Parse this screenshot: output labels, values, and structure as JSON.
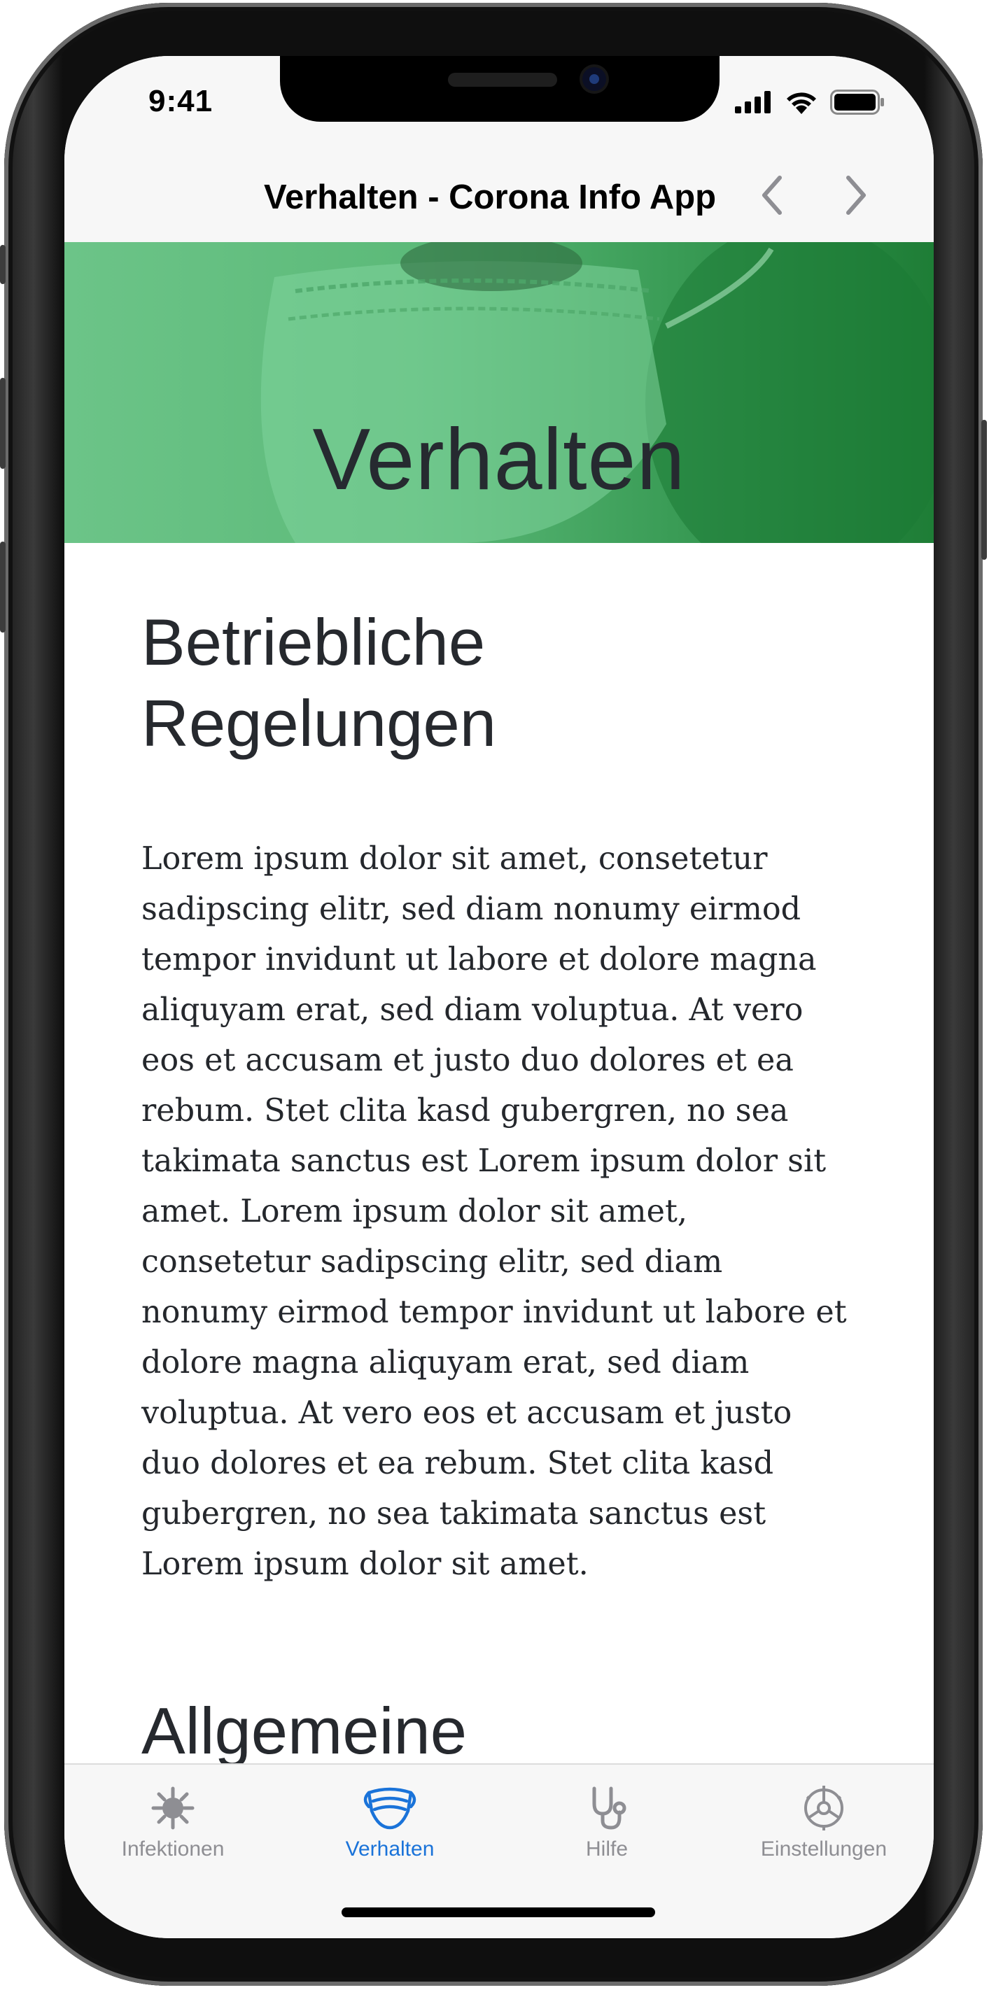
{
  "status_bar": {
    "time": "9:41",
    "icons": [
      "signal-icon",
      "wifi-icon",
      "battery-icon"
    ]
  },
  "nav": {
    "title": "Verhalten - Corona Info App",
    "back_icon": "chevron-left-icon",
    "forward_icon": "chevron-right-icon"
  },
  "banner": {
    "title": "Verhalten",
    "background_color": "#5cba79"
  },
  "content": {
    "heading": "Betriebliche Regelungen",
    "paragraph": "Lorem ipsum dolor sit amet, consetetur sadipscing elitr, sed diam nonumy eirmod tempor invidunt ut labore et dolore magna aliquyam erat, sed diam voluptua. At vero eos et accusam et justo duo dolores et ea rebum. Stet clita kasd gubergren, no sea takimata sanctus est Lorem ipsum dolor sit amet. Lorem ipsum dolor sit amet, consetetur sadipscing elitr, sed diam nonumy eirmod tempor invidunt ut labore et dolore magna aliquyam erat, sed diam voluptua. At vero eos et accusam et justo duo dolores et ea rebum. Stet clita kasd gubergren, no sea takimata sanctus est Lorem ipsum dolor sit amet.",
    "heading2": "Allgemeine"
  },
  "tabs": [
    {
      "label": "Infektionen",
      "icon": "virus-icon",
      "active": false
    },
    {
      "label": "Verhalten",
      "icon": "mask-icon",
      "active": true
    },
    {
      "label": "Hilfe",
      "icon": "stethoscope-icon",
      "active": false
    },
    {
      "label": "Einstellungen",
      "icon": "gear-icon",
      "active": false
    }
  ],
  "colors": {
    "accent": "#1a73d9",
    "tab_inactive": "#8e8e93",
    "text": "#26292e"
  }
}
